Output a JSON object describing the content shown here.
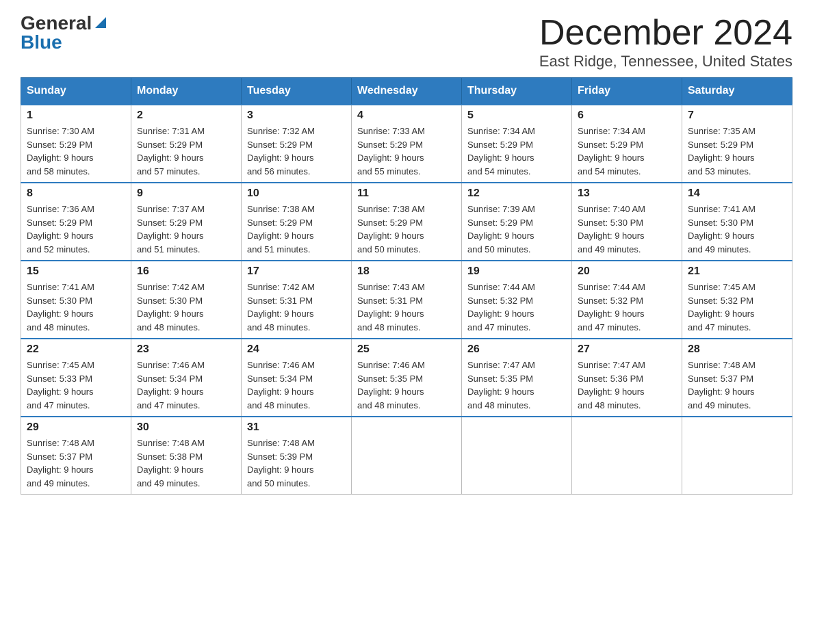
{
  "header": {
    "logo_general": "General",
    "logo_blue": "Blue",
    "month_year": "December 2024",
    "location": "East Ridge, Tennessee, United States"
  },
  "days_of_week": [
    "Sunday",
    "Monday",
    "Tuesday",
    "Wednesday",
    "Thursday",
    "Friday",
    "Saturday"
  ],
  "weeks": [
    [
      {
        "num": "1",
        "sunrise": "7:30 AM",
        "sunset": "5:29 PM",
        "daylight": "9 hours and 58 minutes."
      },
      {
        "num": "2",
        "sunrise": "7:31 AM",
        "sunset": "5:29 PM",
        "daylight": "9 hours and 57 minutes."
      },
      {
        "num": "3",
        "sunrise": "7:32 AM",
        "sunset": "5:29 PM",
        "daylight": "9 hours and 56 minutes."
      },
      {
        "num": "4",
        "sunrise": "7:33 AM",
        "sunset": "5:29 PM",
        "daylight": "9 hours and 55 minutes."
      },
      {
        "num": "5",
        "sunrise": "7:34 AM",
        "sunset": "5:29 PM",
        "daylight": "9 hours and 54 minutes."
      },
      {
        "num": "6",
        "sunrise": "7:34 AM",
        "sunset": "5:29 PM",
        "daylight": "9 hours and 54 minutes."
      },
      {
        "num": "7",
        "sunrise": "7:35 AM",
        "sunset": "5:29 PM",
        "daylight": "9 hours and 53 minutes."
      }
    ],
    [
      {
        "num": "8",
        "sunrise": "7:36 AM",
        "sunset": "5:29 PM",
        "daylight": "9 hours and 52 minutes."
      },
      {
        "num": "9",
        "sunrise": "7:37 AM",
        "sunset": "5:29 PM",
        "daylight": "9 hours and 51 minutes."
      },
      {
        "num": "10",
        "sunrise": "7:38 AM",
        "sunset": "5:29 PM",
        "daylight": "9 hours and 51 minutes."
      },
      {
        "num": "11",
        "sunrise": "7:38 AM",
        "sunset": "5:29 PM",
        "daylight": "9 hours and 50 minutes."
      },
      {
        "num": "12",
        "sunrise": "7:39 AM",
        "sunset": "5:29 PM",
        "daylight": "9 hours and 50 minutes."
      },
      {
        "num": "13",
        "sunrise": "7:40 AM",
        "sunset": "5:30 PM",
        "daylight": "9 hours and 49 minutes."
      },
      {
        "num": "14",
        "sunrise": "7:41 AM",
        "sunset": "5:30 PM",
        "daylight": "9 hours and 49 minutes."
      }
    ],
    [
      {
        "num": "15",
        "sunrise": "7:41 AM",
        "sunset": "5:30 PM",
        "daylight": "9 hours and 48 minutes."
      },
      {
        "num": "16",
        "sunrise": "7:42 AM",
        "sunset": "5:30 PM",
        "daylight": "9 hours and 48 minutes."
      },
      {
        "num": "17",
        "sunrise": "7:42 AM",
        "sunset": "5:31 PM",
        "daylight": "9 hours and 48 minutes."
      },
      {
        "num": "18",
        "sunrise": "7:43 AM",
        "sunset": "5:31 PM",
        "daylight": "9 hours and 48 minutes."
      },
      {
        "num": "19",
        "sunrise": "7:44 AM",
        "sunset": "5:32 PM",
        "daylight": "9 hours and 47 minutes."
      },
      {
        "num": "20",
        "sunrise": "7:44 AM",
        "sunset": "5:32 PM",
        "daylight": "9 hours and 47 minutes."
      },
      {
        "num": "21",
        "sunrise": "7:45 AM",
        "sunset": "5:32 PM",
        "daylight": "9 hours and 47 minutes."
      }
    ],
    [
      {
        "num": "22",
        "sunrise": "7:45 AM",
        "sunset": "5:33 PM",
        "daylight": "9 hours and 47 minutes."
      },
      {
        "num": "23",
        "sunrise": "7:46 AM",
        "sunset": "5:34 PM",
        "daylight": "9 hours and 47 minutes."
      },
      {
        "num": "24",
        "sunrise": "7:46 AM",
        "sunset": "5:34 PM",
        "daylight": "9 hours and 48 minutes."
      },
      {
        "num": "25",
        "sunrise": "7:46 AM",
        "sunset": "5:35 PM",
        "daylight": "9 hours and 48 minutes."
      },
      {
        "num": "26",
        "sunrise": "7:47 AM",
        "sunset": "5:35 PM",
        "daylight": "9 hours and 48 minutes."
      },
      {
        "num": "27",
        "sunrise": "7:47 AM",
        "sunset": "5:36 PM",
        "daylight": "9 hours and 48 minutes."
      },
      {
        "num": "28",
        "sunrise": "7:48 AM",
        "sunset": "5:37 PM",
        "daylight": "9 hours and 49 minutes."
      }
    ],
    [
      {
        "num": "29",
        "sunrise": "7:48 AM",
        "sunset": "5:37 PM",
        "daylight": "9 hours and 49 minutes."
      },
      {
        "num": "30",
        "sunrise": "7:48 AM",
        "sunset": "5:38 PM",
        "daylight": "9 hours and 49 minutes."
      },
      {
        "num": "31",
        "sunrise": "7:48 AM",
        "sunset": "5:39 PM",
        "daylight": "9 hours and 50 minutes."
      },
      null,
      null,
      null,
      null
    ]
  ],
  "labels": {
    "sunrise": "Sunrise:",
    "sunset": "Sunset:",
    "daylight": "Daylight:"
  }
}
